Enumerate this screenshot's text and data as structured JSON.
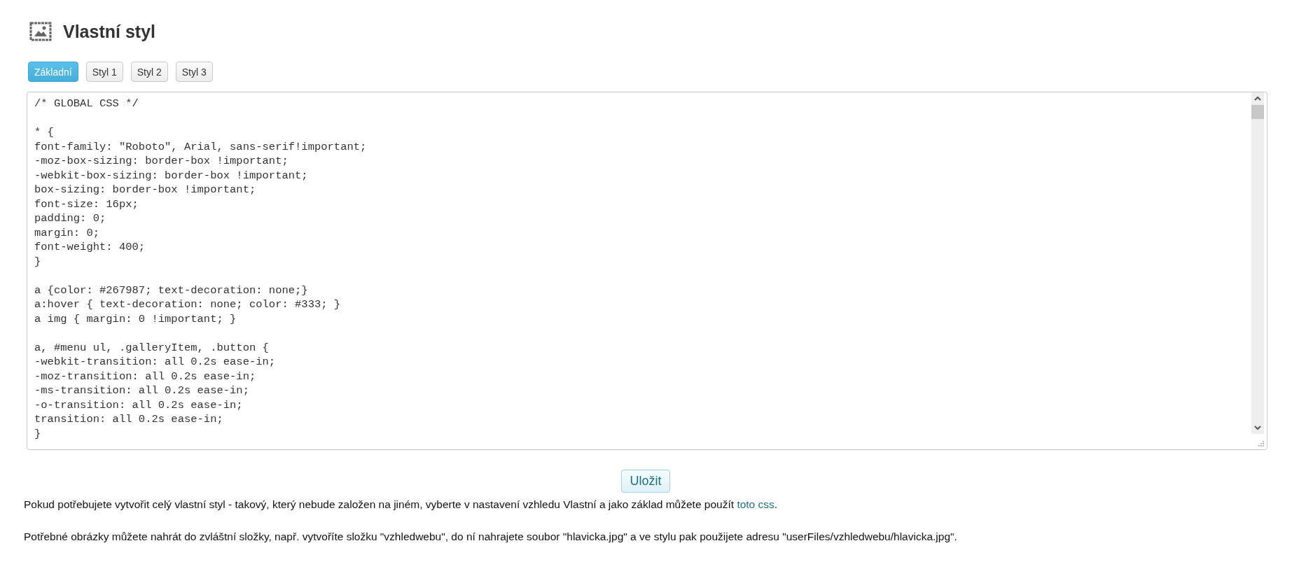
{
  "page": {
    "title": "Vlastní styl"
  },
  "tabs": [
    {
      "label": "Základní",
      "selected": true
    },
    {
      "label": "Styl 1",
      "selected": false
    },
    {
      "label": "Styl 2",
      "selected": false
    },
    {
      "label": "Styl 3",
      "selected": false
    }
  ],
  "editor": {
    "blocks": [
      [
        "/* GLOBAL CSS */"
      ],
      [
        "* {",
        "font-family: \"Roboto\", Arial, sans-serif!important;",
        "-moz-box-sizing: border-box !important;",
        "-webkit-box-sizing: border-box !important;",
        "box-sizing: border-box !important;",
        "font-size: 16px;",
        "padding: 0;",
        "margin: 0;",
        "font-weight: 400;",
        "}"
      ],
      [
        "a {color: #267987; text-decoration: none;}",
        "a:hover { text-decoration: none; color: #333; }",
        "a img { margin: 0 !important; }"
      ],
      [
        "a, #menu ul, .galleryItem, .button {",
        "-webkit-transition: all 0.2s ease-in;",
        "-moz-transition: all 0.2s ease-in;",
        "-ms-transition: all 0.2s ease-in;",
        "-o-transition: all 0.2s ease-in;",
        "transition: all 0.2s ease-in;",
        "}"
      ]
    ]
  },
  "save_button": "Uložit",
  "notes": [
    {
      "text": "Pokud potřebujete vytvořit celý vlastní styl - takový, který nebude založen na jiném, vyberte v nastavení vzhledu Vlastní a jako základ můžete použít ",
      "link": "toto css",
      "after": "."
    },
    {
      "text": "Potřebné obrázky můžete nahrát do zvláštní složky, např. vytvoříte složku \"vzhledwebu\", do ní nahrajete soubor \"hlavicka.jpg\" a ve stylu pak použijete adresu \"userFiles/vzhledwebu/hlavicka.jpg\"."
    }
  ]
}
